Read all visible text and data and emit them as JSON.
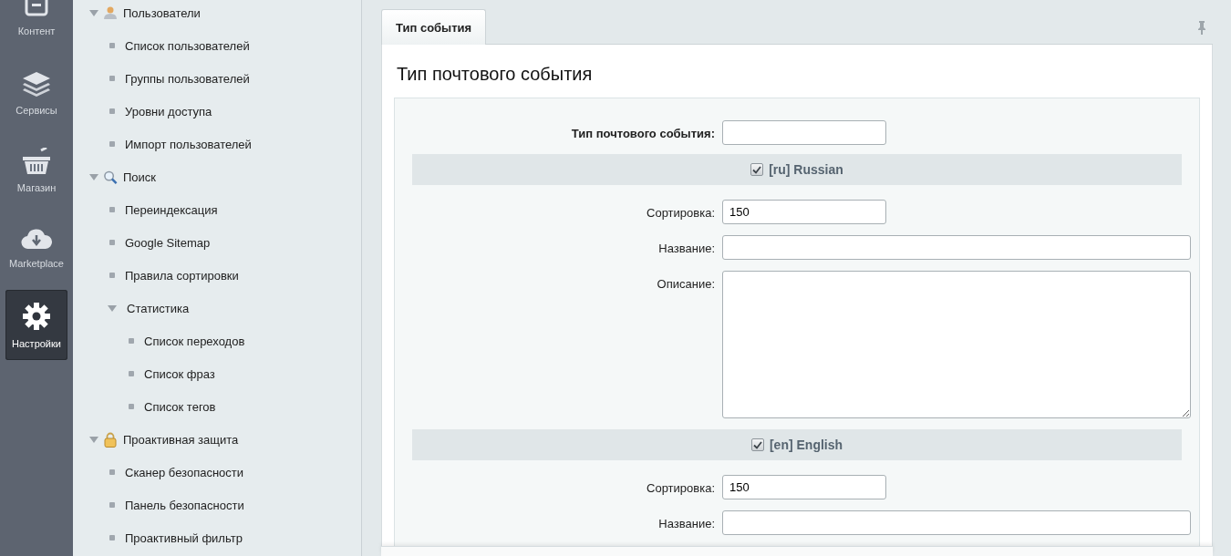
{
  "rail": [
    {
      "label": "Контент",
      "selected": false
    },
    {
      "label": "Сервисы",
      "selected": false
    },
    {
      "label": "Магазин",
      "selected": false
    },
    {
      "label": "Marketplace",
      "selected": false
    },
    {
      "label": "Настройки",
      "selected": true
    }
  ],
  "menu": [
    {
      "label": "Пользователи",
      "expanded": true,
      "children": [
        {
          "label": "Список пользователей"
        },
        {
          "label": "Группы пользователей"
        },
        {
          "label": "Уровни доступа"
        },
        {
          "label": "Импорт пользователей"
        }
      ]
    },
    {
      "label": "Поиск",
      "expanded": true,
      "children": [
        {
          "label": "Переиндексация"
        },
        {
          "label": "Google Sitemap"
        },
        {
          "label": "Правила сортировки"
        },
        {
          "label": "Статистика",
          "expanded": true,
          "children": [
            {
              "label": "Список переходов"
            },
            {
              "label": "Список фраз"
            },
            {
              "label": "Список тегов"
            }
          ]
        }
      ]
    },
    {
      "label": "Проактивная защита",
      "expanded": true,
      "children": [
        {
          "label": "Сканер безопасности"
        },
        {
          "label": "Панель безопасности"
        },
        {
          "label": "Проактивный фильтр"
        }
      ]
    }
  ],
  "tabs": [
    {
      "label": "Тип события",
      "selected": true
    }
  ],
  "form": {
    "title": "Тип почтового события",
    "event_type": {
      "label": "Тип почтового события:"
    },
    "sections": [
      {
        "label": "[ru] Russian",
        "checked": true,
        "fields": [
          {
            "kind": "number",
            "label": "Сортировка:",
            "value": "150"
          },
          {
            "kind": "text",
            "label": "Название:"
          },
          {
            "kind": "textarea",
            "label": "Описание:"
          }
        ]
      },
      {
        "label": "[en] English",
        "checked": true,
        "fields": [
          {
            "kind": "number",
            "label": "Сортировка:",
            "value": "150"
          },
          {
            "kind": "text",
            "label": "Название:"
          }
        ]
      }
    ]
  }
}
